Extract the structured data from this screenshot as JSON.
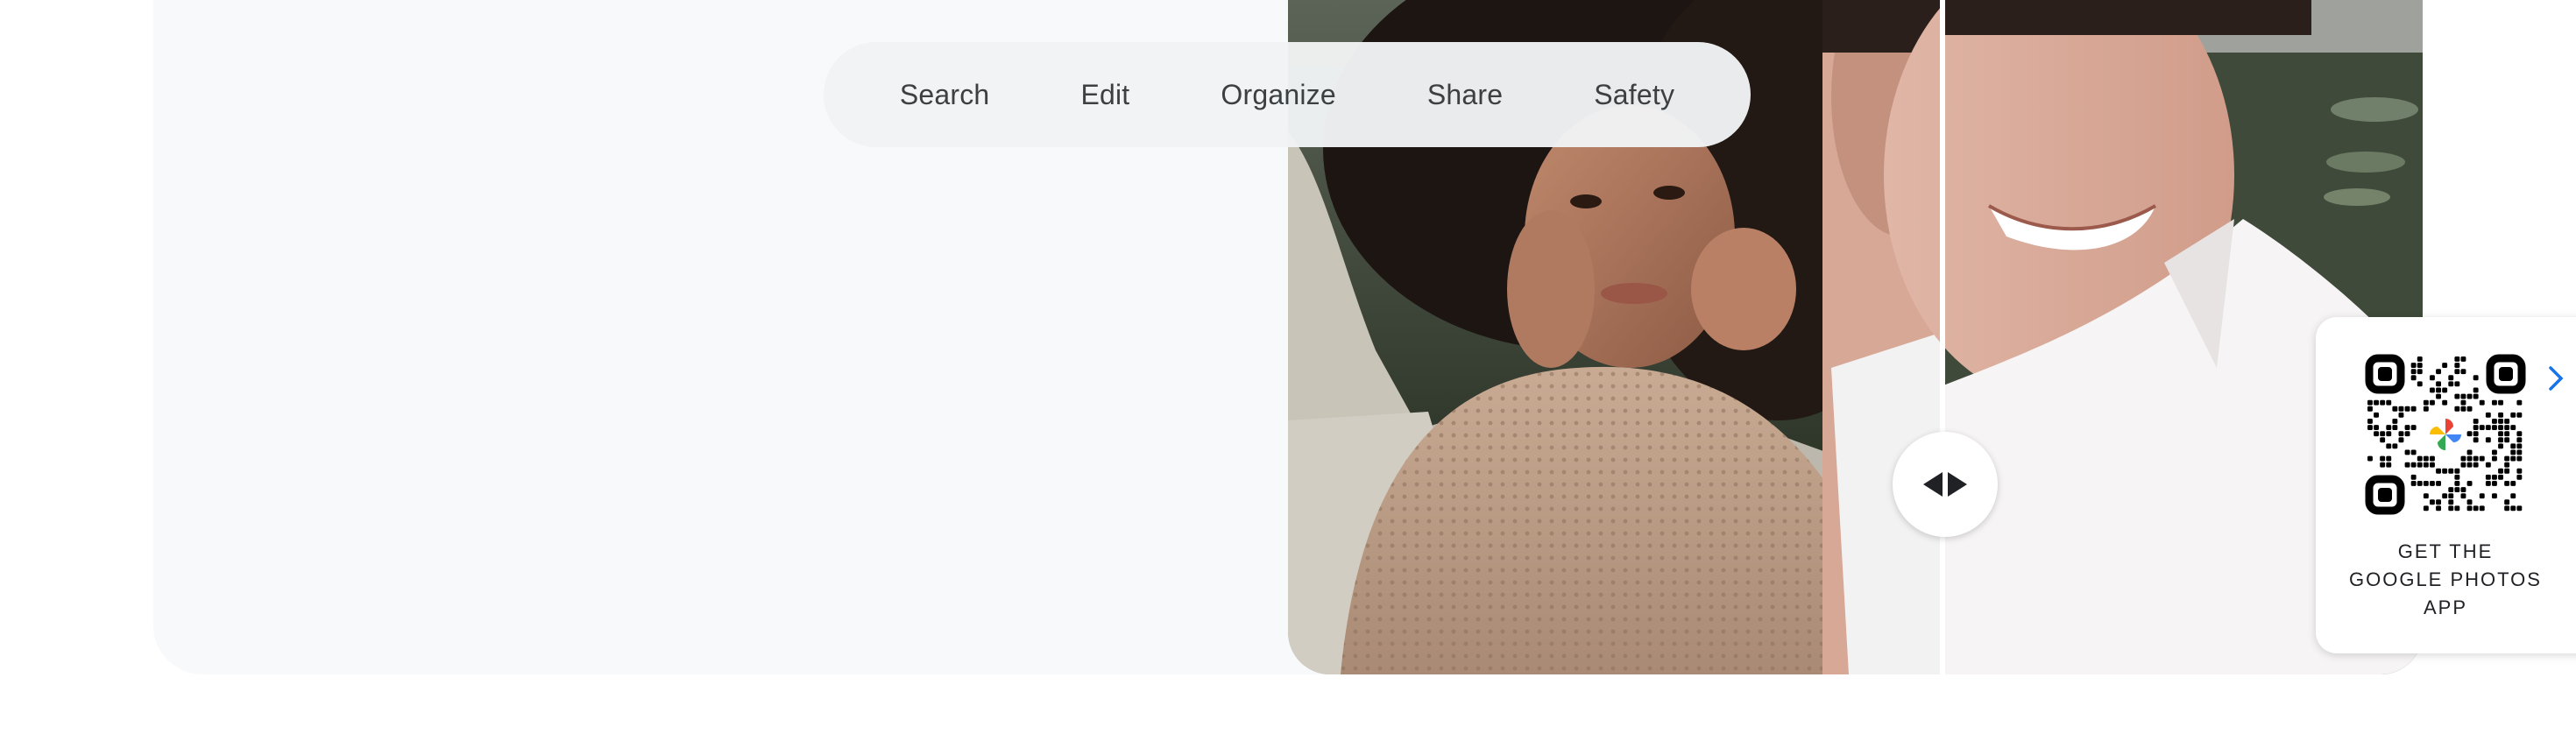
{
  "nav": {
    "items": [
      {
        "label": "Search"
      },
      {
        "label": "Edit"
      },
      {
        "label": "Organize"
      },
      {
        "label": "Share"
      },
      {
        "label": "Safety"
      }
    ]
  },
  "comparison": {
    "left_photo_icon": "photo-before",
    "right_photo_icon": "photo-after",
    "handle_icon": "left-right-arrows-icon"
  },
  "qr_card": {
    "line1": "GET THE",
    "line2": "GOOGLE PHOTOS",
    "line3": "APP",
    "chevron_icon": "chevron-right-icon",
    "chevron_color": "#1a73e8"
  },
  "colors": {
    "card_bg": "#f8f9fa",
    "nav_bg": "#f1f3f4",
    "nav_text": "#3c4043",
    "google_blue": "#4285f4",
    "google_red": "#ea4335",
    "google_yellow": "#fbbc04",
    "google_green": "#34a853"
  }
}
